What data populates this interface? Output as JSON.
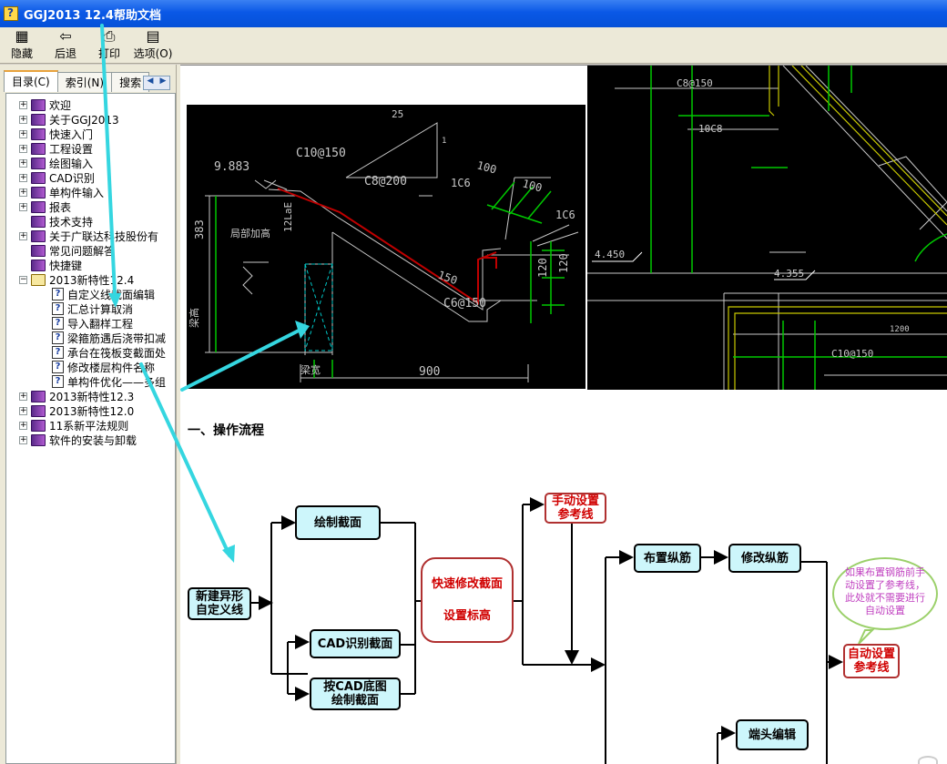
{
  "window": {
    "title": "GGJ2013 12.4帮助文档"
  },
  "toolbar": {
    "items": [
      {
        "label": "隐藏",
        "icon": "hide-icon"
      },
      {
        "label": "后退",
        "icon": "back-arrow-icon"
      },
      {
        "label": "打印",
        "icon": "printer-icon"
      },
      {
        "label": "选项(O)",
        "icon": "options-icon"
      }
    ]
  },
  "tabs": [
    {
      "label": "目录(C)"
    },
    {
      "label": "索引(N)"
    },
    {
      "label": "搜索"
    }
  ],
  "tree": [
    {
      "label": "欢迎",
      "level": 0,
      "type": "book",
      "expander": "+"
    },
    {
      "label": "关于GGJ2013",
      "level": 0,
      "type": "book",
      "expander": "+"
    },
    {
      "label": "快速入门",
      "level": 0,
      "type": "book",
      "expander": "+"
    },
    {
      "label": "工程设置",
      "level": 0,
      "type": "book",
      "expander": "+"
    },
    {
      "label": "绘图输入",
      "level": 0,
      "type": "book",
      "expander": "+"
    },
    {
      "label": "CAD识别",
      "level": 0,
      "type": "book",
      "expander": "+"
    },
    {
      "label": "单构件输入",
      "level": 0,
      "type": "book",
      "expander": "+"
    },
    {
      "label": "报表",
      "level": 0,
      "type": "book",
      "expander": "+"
    },
    {
      "label": "技术支持",
      "level": 0,
      "type": "book",
      "expander": ""
    },
    {
      "label": "关于广联达科技股份有",
      "level": 0,
      "type": "book",
      "expander": "+"
    },
    {
      "label": "常见问题解答",
      "level": 0,
      "type": "book",
      "expander": ""
    },
    {
      "label": "快捷键",
      "level": 0,
      "type": "book",
      "expander": ""
    },
    {
      "label": "2013新特性12.4",
      "level": 0,
      "type": "openbook",
      "expander": "−"
    },
    {
      "label": "自定义线截面编辑",
      "level": 1,
      "type": "page",
      "expander": ""
    },
    {
      "label": "汇总计算取消",
      "level": 1,
      "type": "page",
      "expander": ""
    },
    {
      "label": "导入翻样工程",
      "level": 1,
      "type": "page",
      "expander": ""
    },
    {
      "label": "梁箍筋遇后浇带扣减",
      "level": 1,
      "type": "page",
      "expander": ""
    },
    {
      "label": "承台在筏板变截面处",
      "level": 1,
      "type": "page",
      "expander": ""
    },
    {
      "label": "修改楼层构件名称",
      "level": 1,
      "type": "page",
      "expander": ""
    },
    {
      "label": "单构件优化——多组",
      "level": 1,
      "type": "page",
      "expander": ""
    },
    {
      "label": "2013新特性12.3",
      "level": 0,
      "type": "book",
      "expander": "+"
    },
    {
      "label": "2013新特性12.0",
      "level": 0,
      "type": "book",
      "expander": "+"
    },
    {
      "label": "11系新平法规则",
      "level": 0,
      "type": "book",
      "expander": "+"
    },
    {
      "label": "软件的安装与卸载",
      "level": 0,
      "type": "book",
      "expander": "+"
    }
  ],
  "content": {
    "heading": "一、操作流程",
    "cad1": {
      "labels": [
        "25",
        "1",
        "9.883",
        "C10@150",
        "C8@200",
        "1C6",
        "100",
        "100",
        "1C6",
        "383",
        "局部加高",
        "12LaE",
        "150",
        "120",
        "120",
        "C6@150",
        "梁高",
        "梁宽",
        "900"
      ]
    },
    "cad2": {
      "labels": [
        "C8@150",
        "10C8",
        "4.450",
        "4.355",
        "1200",
        "C10@150"
      ]
    },
    "flow": {
      "new_line": "新建异形\n自定义线",
      "draw_section": "绘制截面",
      "cad_identify": "CAD识别截面",
      "cad_draw": "按CAD底图\n绘制截面",
      "quick_modify": "快速修改截面",
      "set_elevation": "设置标高",
      "manual_ref": "手动设置\n参考线",
      "place_rebar": "布置纵筋",
      "modify_rebar": "修改纵筋",
      "auto_ref": "自动设置\n参考线",
      "end_edit": "端头编辑",
      "note": "如果布置钢筋前手动设置了参考线，此处就不需要进行自动设置"
    }
  },
  "colors": {
    "titlebar": "#0a58e6",
    "accent_cyan": "#35d6e0",
    "flow_box": "#cdf6fb",
    "flow_red": "#d00000",
    "cad_bg": "#000000"
  }
}
